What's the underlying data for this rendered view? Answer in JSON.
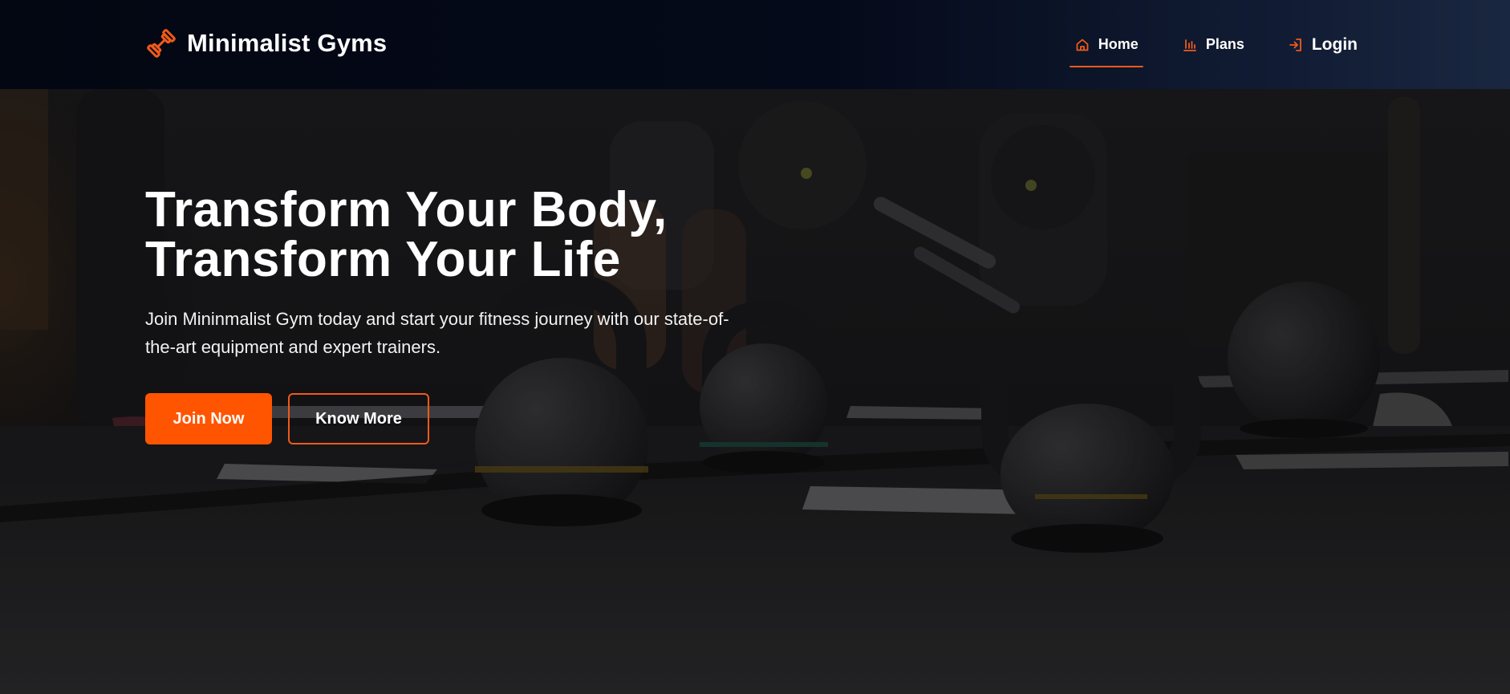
{
  "colors": {
    "accent": "#ff5500",
    "nav_bg": "#030712",
    "text": "#ffffff"
  },
  "navbar": {
    "brand": {
      "icon": "dumbbell-icon",
      "name": "Minimalist Gyms"
    },
    "links": [
      {
        "label": "Home",
        "icon": "home-icon",
        "active": true
      },
      {
        "label": "Plans",
        "icon": "bar-chart-icon",
        "active": false
      },
      {
        "label": "Login",
        "icon": "login-icon",
        "active": false
      }
    ]
  },
  "hero": {
    "title_line1": "Transform Your Body,",
    "title_line2": "Transform Your Life",
    "subtitle": "Join Mininmalist Gym today and start your fitness journey with our state-of-the-art equipment and expert trainers.",
    "primary_cta": "Join Now",
    "secondary_cta": "Know More"
  }
}
